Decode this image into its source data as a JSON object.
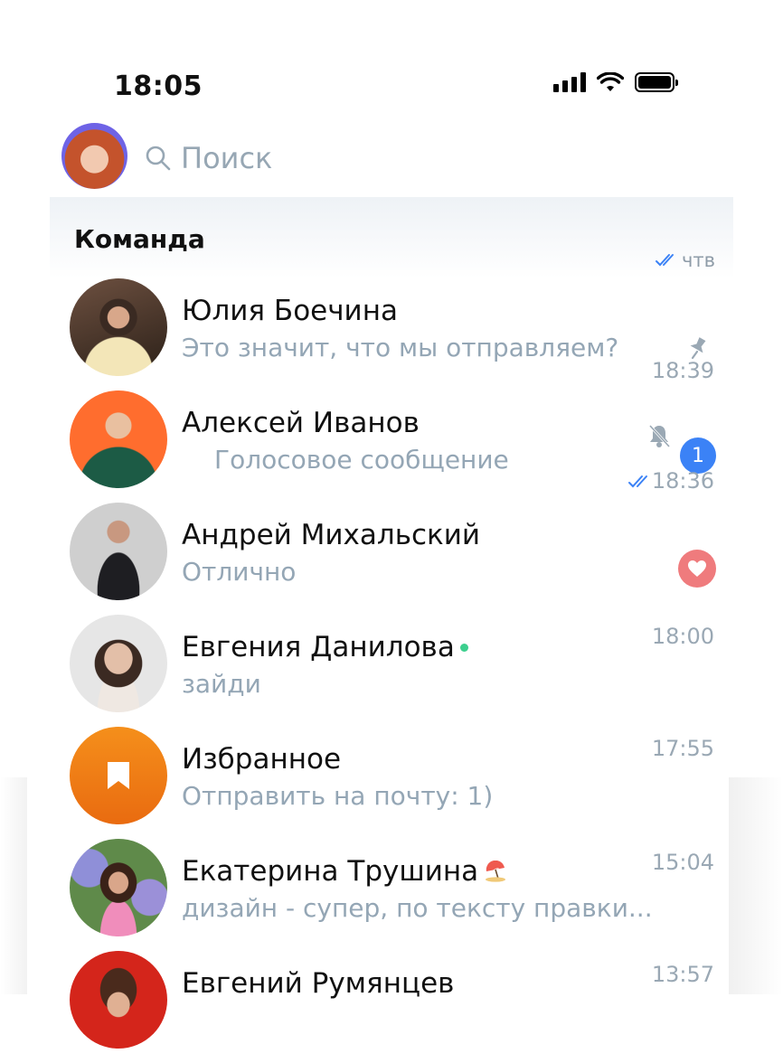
{
  "status_bar": {
    "time": "18:05"
  },
  "search": {
    "placeholder": "Поиск"
  },
  "folder": {
    "title": "Команда",
    "time": "чтв"
  },
  "chats": [
    {
      "name": "Юлия Боечина",
      "message": "Это значит, что мы отправляем?",
      "time": "18:39",
      "pinned": true
    },
    {
      "name": "Алексей Иванов",
      "message": "Голосовое сообщение",
      "time": "18:36",
      "muted": true,
      "unread": "1",
      "read": true
    },
    {
      "name": "Андрей Михальский",
      "message": "Отлично",
      "time": "",
      "reaction": "heart"
    },
    {
      "name": "Евгения Данилова",
      "message": "зайди",
      "time": "18:00",
      "online": true
    },
    {
      "name": "Избранное",
      "message": "Отправить на почту: 1)",
      "time": "17:55"
    },
    {
      "name": "Екатерина Трушина",
      "message": "дизайн - супер, по тексту правки...",
      "time": "15:04"
    },
    {
      "name": "Евгений Румянцев",
      "message": "",
      "time": "13:57"
    }
  ],
  "colors": {
    "accent": "#3b82f6",
    "secondary_text": "#94a6b5",
    "online": "#3ccf8e",
    "reaction": "#ef7b7d",
    "saved_messages": "#f07c17"
  }
}
